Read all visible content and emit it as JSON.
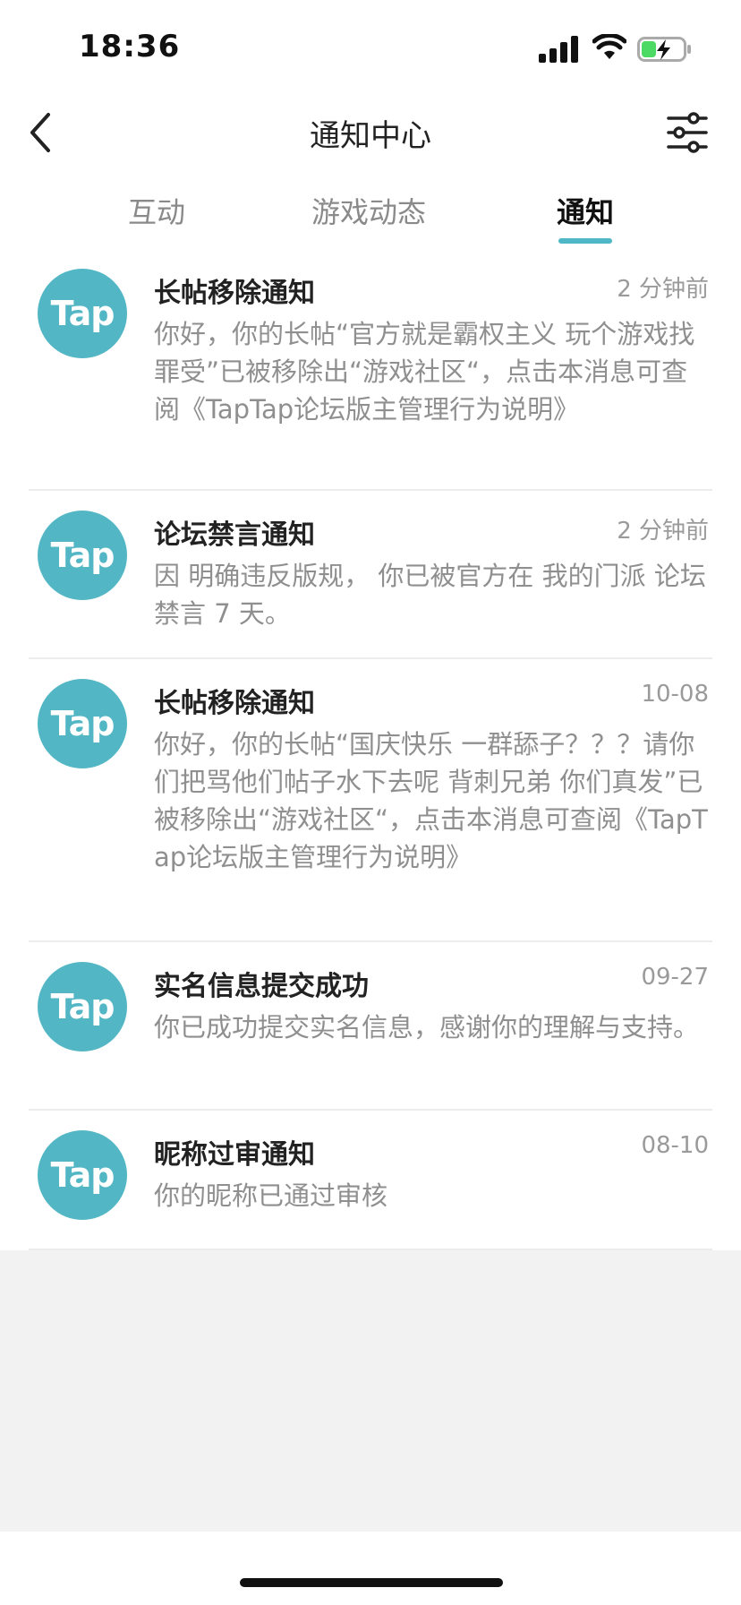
{
  "status_bar": {
    "time": "18:36"
  },
  "header": {
    "title": "通知中心"
  },
  "tabs": [
    {
      "label": "互动",
      "active": false
    },
    {
      "label": "游戏动态",
      "active": false
    },
    {
      "label": "通知",
      "active": true
    }
  ],
  "notifications": [
    {
      "avatar_text": "Tap",
      "title": "长帖移除通知",
      "time": "2 分钟前",
      "body": "你好，你的长帖“官方就是霸权主义 玩个游戏找罪受”已被移除出“游戏社区“，点击本消息可查阅《TapTap论坛版主管理行为说明》"
    },
    {
      "avatar_text": "Tap",
      "title": "论坛禁言通知",
      "time": "2 分钟前",
      "body": "因 明确违反版规， 你已被官方在 我的门派 论坛禁言 7 天。"
    },
    {
      "avatar_text": "Tap",
      "title": "长帖移除通知",
      "time": "10-08",
      "body": "你好，你的长帖“国庆快乐 一群舔子？？？请你们把骂他们帖子水下去呢 背刺兄弟 你们真发”已被移除出“游戏社区“，点击本消息可查阅《TapTap论坛版主管理行为说明》"
    },
    {
      "avatar_text": "Tap",
      "title": "实名信息提交成功",
      "time": "09-27",
      "body": "你已成功提交实名信息，感谢你的理解与支持。"
    },
    {
      "avatar_text": "Tap",
      "title": "昵称过审通知",
      "time": "08-10",
      "body": "你的昵称已通过审核"
    }
  ],
  "colors": {
    "accent": "#4fb7c6",
    "avatar": "#52b6c5",
    "page_background": "#f2f2f2"
  }
}
